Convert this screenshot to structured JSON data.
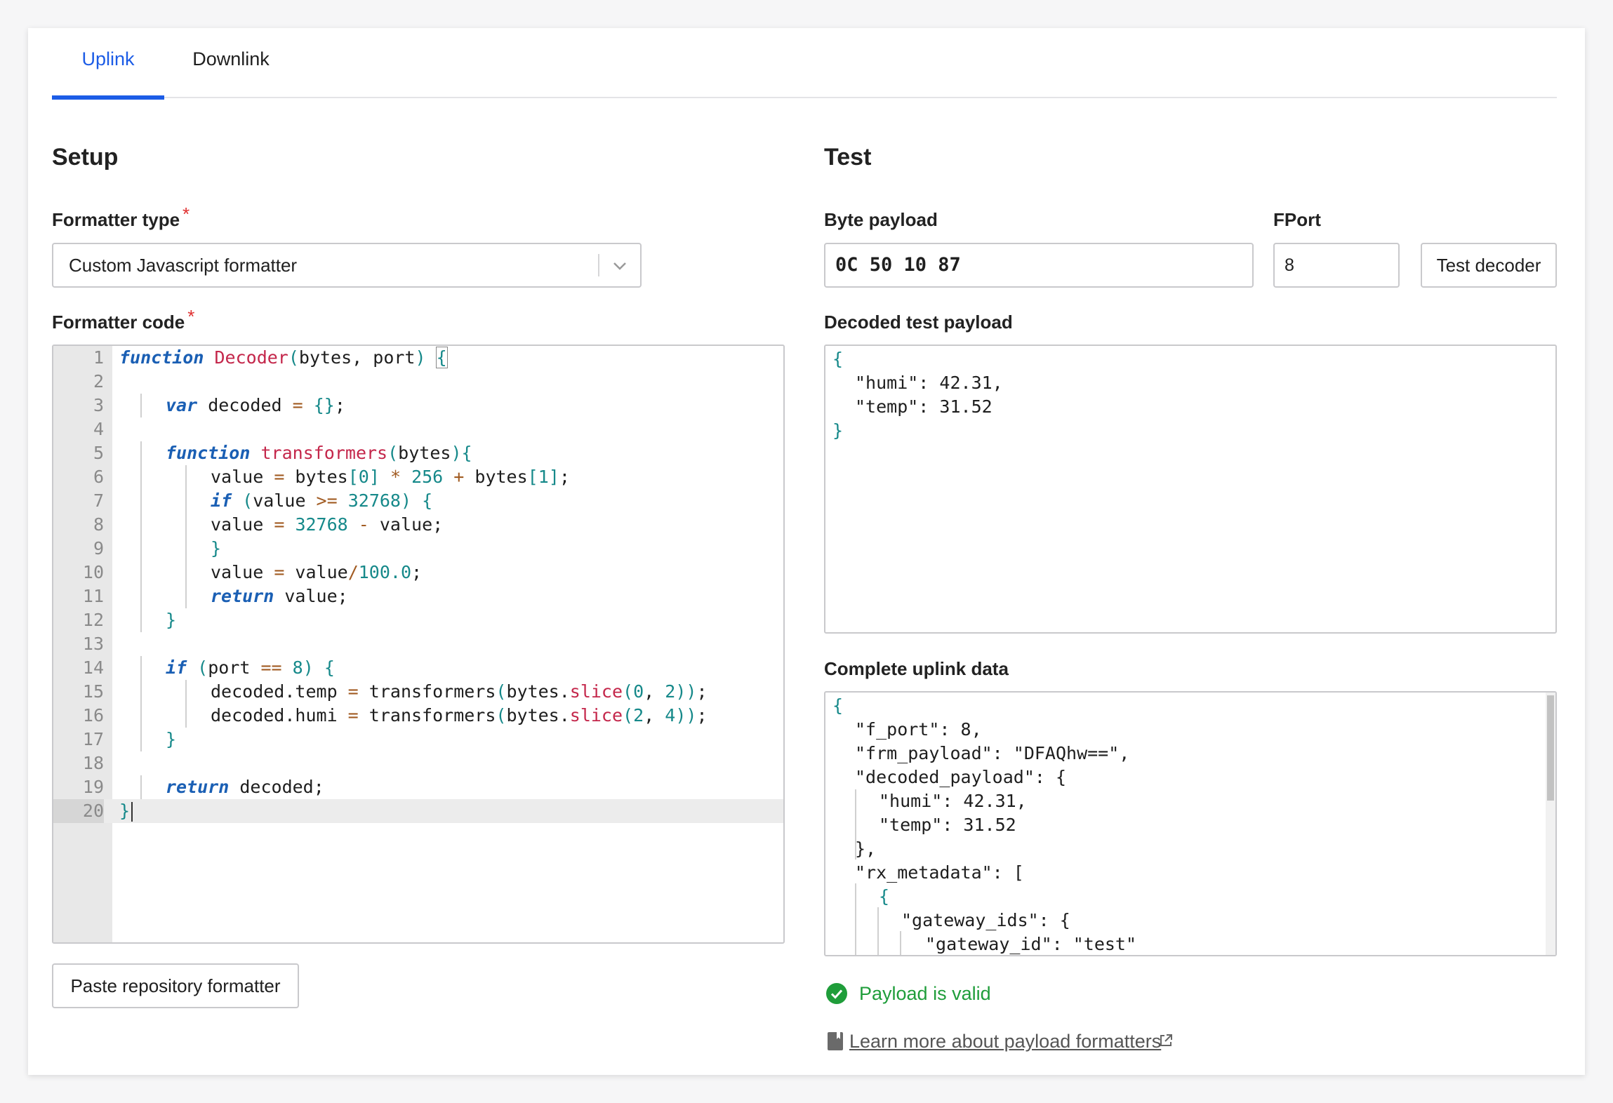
{
  "tabs": [
    {
      "label": "Uplink",
      "active": true
    },
    {
      "label": "Downlink",
      "active": false
    }
  ],
  "setup": {
    "heading": "Setup",
    "formatter_type_label": "Formatter type",
    "required_mark": "*",
    "formatter_type_value": "Custom Javascript formatter",
    "formatter_code_label": "Formatter code",
    "paste_button": "Paste repository formatter",
    "code_lines": [
      {
        "n": "1",
        "text": "function Decoder(bytes, port) {"
      },
      {
        "n": "2",
        "text": ""
      },
      {
        "n": "3",
        "text": "var decoded = {};"
      },
      {
        "n": "4",
        "text": ""
      },
      {
        "n": "5",
        "text": "function transformers(bytes){"
      },
      {
        "n": "6",
        "text": "value = bytes[0] * 256 + bytes[1];"
      },
      {
        "n": "7",
        "text": "if (value >= 32768) {"
      },
      {
        "n": "8",
        "text": "value = 32768 - value;"
      },
      {
        "n": "9",
        "text": "}"
      },
      {
        "n": "10",
        "text": "value = value/100.0;"
      },
      {
        "n": "11",
        "text": "return value;"
      },
      {
        "n": "12",
        "text": "}"
      },
      {
        "n": "13",
        "text": ""
      },
      {
        "n": "14",
        "text": "if (port == 8) {"
      },
      {
        "n": "15",
        "text": "decoded.temp = transformers(bytes.slice(0, 2));"
      },
      {
        "n": "16",
        "text": "decoded.humi = transformers(bytes.slice(2, 4));"
      },
      {
        "n": "17",
        "text": "}"
      },
      {
        "n": "18",
        "text": ""
      },
      {
        "n": "19",
        "text": "return decoded;"
      },
      {
        "n": "20",
        "text": "}"
      }
    ]
  },
  "test": {
    "heading": "Test",
    "byte_payload_label": "Byte payload",
    "byte_payload_value": "0C 50 10 87",
    "fport_label": "FPort",
    "fport_value": "8",
    "test_button": "Test decoder",
    "decoded_label": "Decoded test payload",
    "decoded_lines": [
      "{",
      "\"humi\": 42.31,",
      "\"temp\": 31.52",
      "}"
    ],
    "uplink_label": "Complete uplink data",
    "uplink_lines": [
      "{",
      "\"f_port\": 8,",
      "\"frm_payload\": \"DFAQhw==\",",
      "\"decoded_payload\": {",
      "\"humi\": 42.31,",
      "\"temp\": 31.52",
      "},",
      "\"rx_metadata\": [",
      "{",
      "\"gateway_ids\": {",
      "\"gateway_id\": \"test\""
    ],
    "valid_text": "Payload is valid",
    "learn_more": "Learn more about payload formatters"
  },
  "colors": {
    "accent": "#1c5ce6",
    "valid": "#1f9d3a",
    "required": "#e03030"
  },
  "icons": [
    "chevron-down-icon",
    "check-circle-icon",
    "book-icon",
    "external-link-icon"
  ]
}
